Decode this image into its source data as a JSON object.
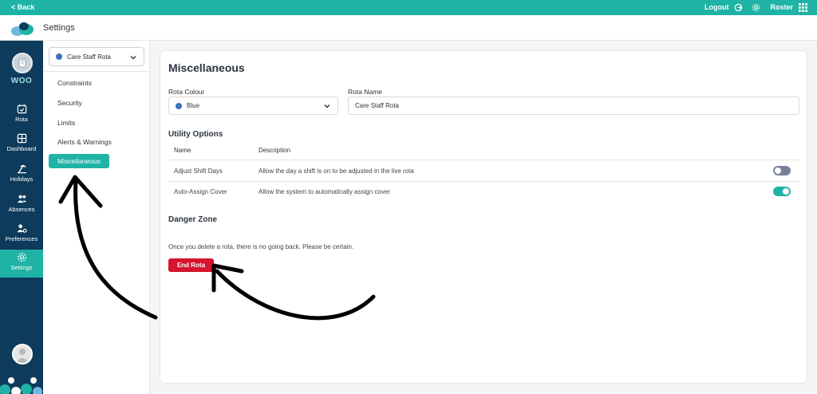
{
  "topbar": {
    "back_label": "< Back",
    "logout_label": "Logout",
    "roster_label": "Roster"
  },
  "header": {
    "title": "Settings"
  },
  "leftnav": {
    "brand": "WOO",
    "items": [
      {
        "label": "Rota",
        "icon": "calendar-icon"
      },
      {
        "label": "Dashboard",
        "icon": "dashboard-icon"
      },
      {
        "label": "Holidays",
        "icon": "holidays-icon"
      },
      {
        "label": "Absences",
        "icon": "absences-icon"
      },
      {
        "label": "Preferences",
        "icon": "preferences-icon"
      },
      {
        "label": "Settings",
        "icon": "gear-icon",
        "active": true
      }
    ]
  },
  "sidepanel": {
    "rota_select": "Care Staff Rota",
    "items": [
      {
        "label": "Constraints"
      },
      {
        "label": "Security"
      },
      {
        "label": "Limits"
      },
      {
        "label": "Alerts & Warnings"
      },
      {
        "label": "Miscellaneous",
        "active": true
      }
    ]
  },
  "main": {
    "title": "Miscellaneous",
    "rota_colour_label": "Rota Colour",
    "rota_colour_value": "Blue",
    "rota_name_label": "Rota Name",
    "rota_name_value": "Care Staff Rota",
    "utility": {
      "title": "Utility Options",
      "col_name": "Name",
      "col_description": "Description",
      "rows": [
        {
          "name": "Adjust Shift Days",
          "description": "Allow the day a shift is on to be adjusted in the live rota",
          "enabled": false
        },
        {
          "name": "Auto-Assign Cover",
          "description": "Allow the system to automatically assign cover",
          "enabled": true
        }
      ]
    },
    "danger": {
      "title": "Danger Zone",
      "text": "Once you delete a rota, there is no going back. Please be certain.",
      "button": "End Rota"
    }
  },
  "colors": {
    "accent": "#1fb3a5",
    "nav_bg": "#0e3b5c",
    "danger": "#d6142c",
    "rota_blue": "#3b73b9",
    "toggle_off": "#7a7f9a"
  }
}
